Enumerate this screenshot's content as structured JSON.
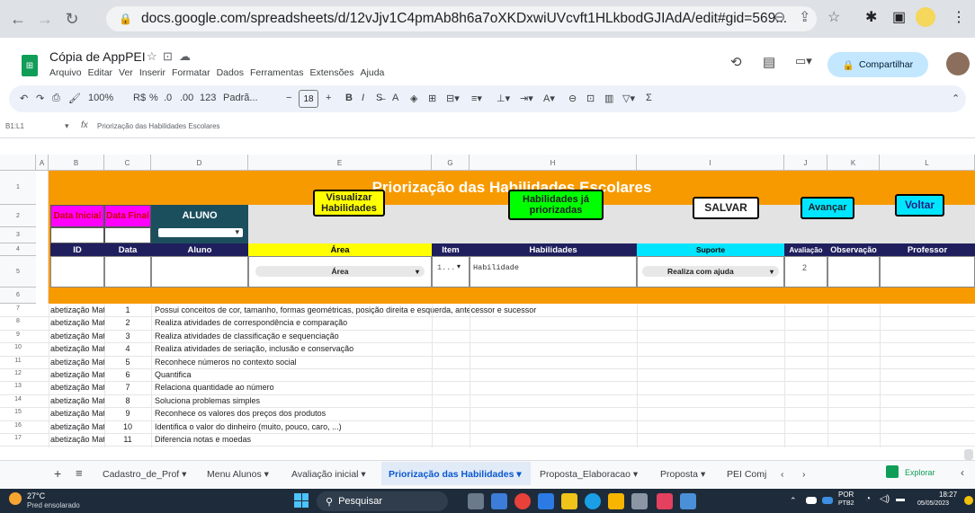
{
  "browser": {
    "url": "docs.google.com/spreadsheets/d/12vJjv1C4pmAb8h6a7oXKDxwiUVcvft1HLkbodGJIAdA/edit#gid=569..."
  },
  "doc": {
    "title": "Cópia de AppPEI",
    "menus": [
      "Arquivo",
      "Editar",
      "Ver",
      "Inserir",
      "Formatar",
      "Dados",
      "Ferramentas",
      "Extensões",
      "Ajuda"
    ],
    "share_label": "Compartilhar"
  },
  "toolbar": {
    "zoom": "100%",
    "currency": "R$",
    "percent": "%",
    "dec_less": ".0",
    "dec_more": ".00",
    "format_123": "123",
    "font": "Padrã...",
    "font_size": "18"
  },
  "formula_bar": {
    "cell_ref": "B1:L1",
    "content": "Priorização das Habilidades Escolares"
  },
  "columns": [
    "A",
    "B",
    "C",
    "D",
    "E",
    "G",
    "H",
    "I",
    "J",
    "K",
    "L"
  ],
  "sheet": {
    "banner_title": "Priorização das Habilidades Escolares",
    "label_data_inicial": "Data Inicial",
    "label_data_final": "Data Final",
    "label_aluno": "ALUNO",
    "btn_visualizar": "Visualizar Habilidades",
    "btn_priorizadas": "Habilidades já priorizadas",
    "btn_salvar": "SALVAR",
    "btn_avancar": "Avançar",
    "btn_voltar": "Voltar",
    "headers": {
      "id": "ID",
      "data": "Data",
      "aluno": "Aluno",
      "area": "Área",
      "item": "Item",
      "habilidades": "Habilidades",
      "suporte": "Suporte",
      "avaliacao": "Avaliação",
      "observacao": "Observação",
      "professor": "Professor"
    },
    "input_row": {
      "area": "Área",
      "item": "1...",
      "habilidade": "Habilidade",
      "suporte": "Realiza com ajuda",
      "avaliacao": "2"
    }
  },
  "rows": [
    {
      "rownum": "7",
      "area": "abetização Maten",
      "item": "1",
      "text": "Possui conceitos de cor, tamanho, formas geométricas, posição direita e esquerda, antecessor e sucessor"
    },
    {
      "rownum": "8",
      "area": "abetização Maten",
      "item": "2",
      "text": "Realiza atividades de correspondência e comparação"
    },
    {
      "rownum": "9",
      "area": "abetização Maten",
      "item": "3",
      "text": "Realiza atividades de classificação e sequenciação"
    },
    {
      "rownum": "10",
      "area": "abetização Maten",
      "item": "4",
      "text": "Realiza atividades de seriação, inclusão e conservação"
    },
    {
      "rownum": "11",
      "area": "abetização Maten",
      "item": "5",
      "text": "Reconhece números no contexto social"
    },
    {
      "rownum": "12",
      "area": "abetização Maten",
      "item": "6",
      "text": "Quantifica"
    },
    {
      "rownum": "13",
      "area": "abetização Maten",
      "item": "7",
      "text": "Relaciona quantidade ao número"
    },
    {
      "rownum": "14",
      "area": "abetização Maten",
      "item": "8",
      "text": "Soluciona problemas simples"
    },
    {
      "rownum": "15",
      "area": "abetização Maten",
      "item": "9",
      "text": "Reconhece os valores dos preços dos produtos"
    },
    {
      "rownum": "16",
      "area": "abetização Maten",
      "item": "10",
      "text": "Identifica o valor do dinheiro (muito, pouco, caro, ...)"
    },
    {
      "rownum": "17",
      "area": "abetização Maten",
      "item": "11",
      "text": "Diferencia notas e moedas"
    }
  ],
  "tabs": [
    "Cadastro_de_Prof",
    "Menu Alunos",
    "Avaliação inicial",
    "Priorização das Habilidades",
    "Proposta_Elaboracao",
    "Proposta",
    "PEI Comj"
  ],
  "explore_label": "Explorar",
  "taskbar": {
    "weather_temp": "27°C",
    "weather_text": "Pred ensolarado",
    "search": "Pesquisar",
    "lang1": "POR",
    "lang2": "PTB2",
    "time": "18:27",
    "date": "05/05/2023"
  },
  "colors": {
    "orange": "#f79a00",
    "magenta": "#ff00ff",
    "navy": "#1f1f5e",
    "yellow": "#ffff00",
    "green": "#00ff00",
    "cyan": "#00e5ff",
    "teal": "#1c4f5e"
  }
}
